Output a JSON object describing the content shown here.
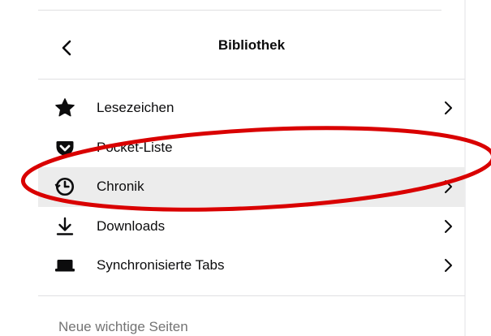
{
  "panel": {
    "title": "Bibliothek",
    "back_icon": "chevron-left-icon"
  },
  "menu": {
    "items": [
      {
        "label": "Lesezeichen",
        "icon": "star-icon",
        "has_submenu": true
      },
      {
        "label": "Pocket-Liste",
        "icon": "pocket-icon",
        "has_submenu": false
      },
      {
        "label": "Chronik",
        "icon": "history-clock-icon",
        "has_submenu": true,
        "hovered": true
      },
      {
        "label": "Downloads",
        "icon": "download-arrow-icon",
        "has_submenu": true
      },
      {
        "label": "Synchronisierte Tabs",
        "icon": "synced-tabs-laptop-icon",
        "has_submenu": true
      }
    ]
  },
  "section": {
    "label": "Neue wichtige Seiten"
  },
  "annotation": {
    "type": "ellipse-highlight",
    "target": "Pocket-Liste",
    "color": "#d90000"
  },
  "colors": {
    "hover_background": "#ececec",
    "separator": "#e0e0e2",
    "muted_text": "#737373",
    "icon": "#0c0c0d"
  }
}
